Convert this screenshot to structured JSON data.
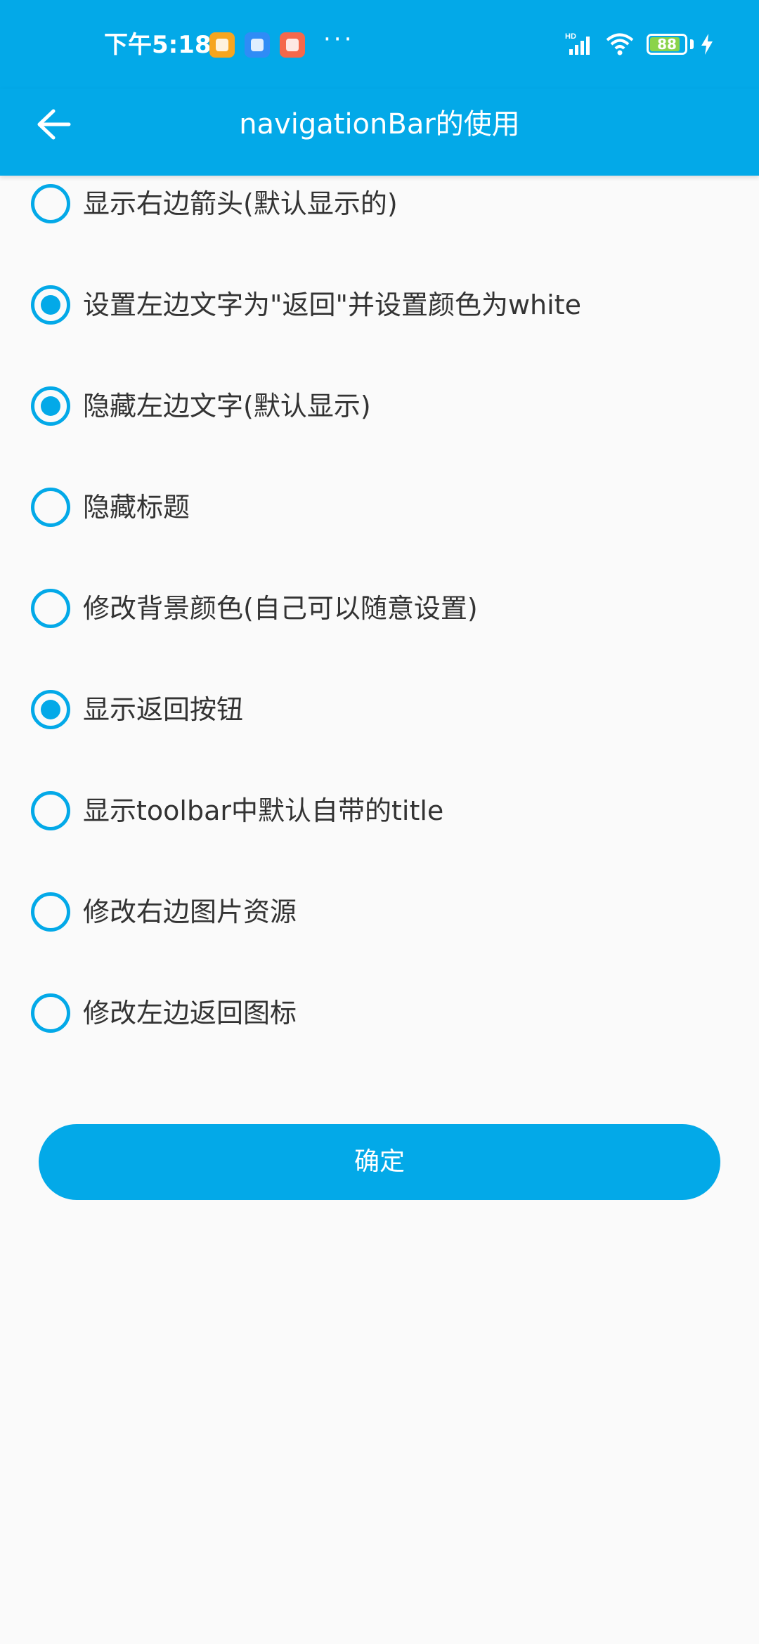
{
  "status_bar": {
    "time": "下午5:18",
    "more": "···",
    "network_type": "HD",
    "battery_level": "88",
    "battery_fraction": 0.88,
    "icons": [
      "app-notification-icon",
      "app-notification-icon",
      "app-notification-icon",
      "signal-icon",
      "wifi-icon",
      "battery-icon",
      "charging-icon"
    ]
  },
  "toolbar": {
    "title": "navigationBar的使用",
    "back_icon": "arrow-left-icon"
  },
  "colors": {
    "primary": "#03a9e8",
    "background": "#fafafa",
    "text": "#333333"
  },
  "options": [
    {
      "label": "显示右边箭头(默认显示的)",
      "checked": false
    },
    {
      "label": "设置左边文字为\"返回\"并设置颜色为white",
      "checked": true
    },
    {
      "label": "隐藏左边文字(默认显示)",
      "checked": true
    },
    {
      "label": "隐藏标题",
      "checked": false
    },
    {
      "label": "修改背景颜色(自己可以随意设置)",
      "checked": false
    },
    {
      "label": "显示返回按钮",
      "checked": true
    },
    {
      "label": "显示toolbar中默认自带的title",
      "checked": false
    },
    {
      "label": "修改右边图片资源",
      "checked": false
    },
    {
      "label": "修改左边返回图标",
      "checked": false
    }
  ],
  "confirm_button": {
    "label": "确定"
  }
}
